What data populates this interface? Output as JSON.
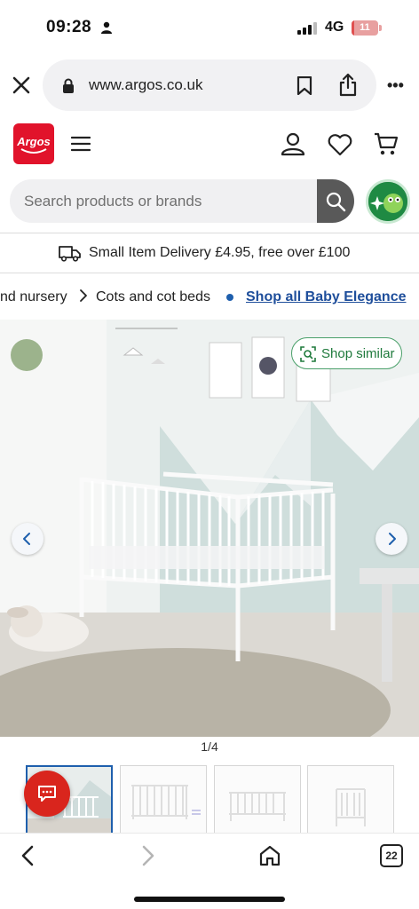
{
  "status_bar": {
    "time": "09:28",
    "network": "4G",
    "battery_level": "11",
    "battery_fraction": 0.11
  },
  "browser": {
    "url": "www.argos.co.uk",
    "tab_count": "22",
    "icons": [
      "close-icon",
      "lock-icon",
      "bookmark-icon",
      "share-icon",
      "more-icon"
    ]
  },
  "header": {
    "logo_text": "Argos",
    "brand_color": "#e1132b",
    "icons": [
      "menu-icon",
      "account-icon",
      "heart-icon",
      "basket-icon"
    ]
  },
  "search": {
    "placeholder": "Search products or brands"
  },
  "delivery": {
    "text": "Small Item Delivery £4.95, free over £100"
  },
  "breadcrumb": {
    "items": [
      "nd nursery",
      "Cots and cot beds"
    ],
    "shop_all": "Shop all Baby Elegance",
    "link_color": "#1e4e9b"
  },
  "gallery": {
    "shop_similar": "Shop similar",
    "counter": "1/4",
    "accent_color": "#1f7a3c"
  }
}
